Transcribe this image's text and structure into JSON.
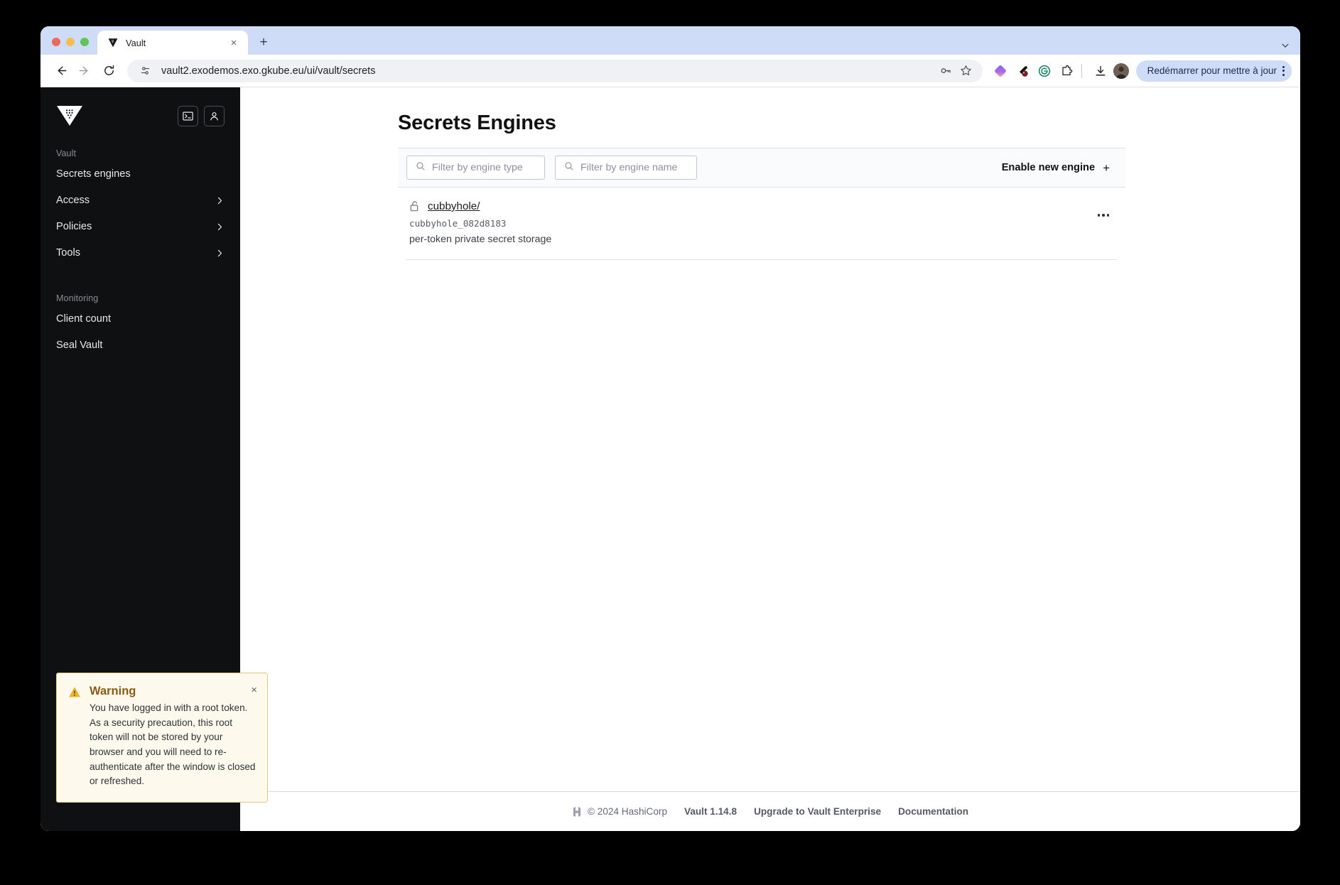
{
  "browser": {
    "tab": {
      "title": "Vault",
      "favicon": "vault-logo-icon",
      "close_label": "×"
    },
    "new_tab_label": "+",
    "omnibox": {
      "url": "vault2.exodemos.exo.gkube.eu/ui/vault/secrets"
    },
    "toolbar_icons": [
      "back-arrow-icon",
      "forward-arrow-icon",
      "reload-icon",
      "site-settings-icon",
      "password-key-icon",
      "bookmark-star-icon",
      "extension-gradient-icon",
      "extension-colorpick-icon",
      "grammarly-icon",
      "extensions-puzzle-icon",
      "download-icon",
      "profile-avatar"
    ],
    "update_pill": {
      "label": "Redémarrer pour mettre à jour"
    }
  },
  "sidebar": {
    "logo": "vault-logo-icon",
    "actions": [
      {
        "name": "console-toggle-button",
        "icon": "terminal-icon"
      },
      {
        "name": "user-menu-button",
        "icon": "user-icon"
      }
    ],
    "sections": [
      {
        "label": "Vault",
        "items": [
          {
            "label": "Secrets engines",
            "has_chevron": false
          },
          {
            "label": "Access",
            "has_chevron": true
          },
          {
            "label": "Policies",
            "has_chevron": true
          },
          {
            "label": "Tools",
            "has_chevron": true
          }
        ]
      },
      {
        "label": "Monitoring",
        "items": [
          {
            "label": "Client count",
            "has_chevron": false
          },
          {
            "label": "Seal Vault",
            "has_chevron": false
          }
        ]
      }
    ]
  },
  "main": {
    "title": "Secrets Engines",
    "filters": {
      "engine_type_placeholder": "Filter by engine type",
      "engine_type_value": "",
      "engine_name_placeholder": "Filter by engine name",
      "engine_name_value": ""
    },
    "enable_new_engine": {
      "label": "Enable new engine",
      "plus": "+"
    },
    "engines": [
      {
        "path": "cubbyhole/",
        "id": "cubbyhole_082d8183",
        "description": "per-token private secret storage",
        "icon": "unlock-icon"
      }
    ]
  },
  "footer": {
    "mark": "hashicorp-icon",
    "copyright": "© 2024 HashiCorp",
    "version": "Vault 1.14.8",
    "upgrade_link": "Upgrade to Vault Enterprise",
    "docs_link": "Documentation"
  },
  "toast": {
    "icon": "warning-triangle-icon",
    "title": "Warning",
    "message": "You have logged in with a root token. As a security precaution, this root token will not be stored by your browser and you will need to re-authenticate after the window is closed or refreshed.",
    "close": "×"
  },
  "colors": {
    "sidebar_bg": "#0f1011",
    "tabstrip_bg": "#cfdcf7",
    "warning_bg": "#fdf9ed",
    "warning_border": "#e0c97a",
    "warning_title": "#8a5c12",
    "accent_update_pill": "#cfdcf7"
  }
}
